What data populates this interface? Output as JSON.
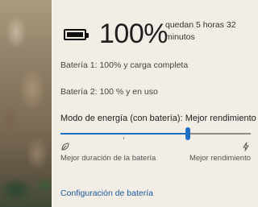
{
  "battery": {
    "percent": "100%",
    "remaining": "quedan 5 horas 32 minutos",
    "battery1_status": "Batería 1: 100% y carga completa",
    "battery2_status": "Batería 2: 100 % y en uso",
    "level_fraction": 1.0
  },
  "power_mode": {
    "label": "Modo de energía (con batería): Mejor rendimiento",
    "slider_value": 0.67,
    "tick_marks": [
      0.33,
      0.67
    ],
    "min_label": "Mejor duración de la batería",
    "max_label": "Mejor rendimiento",
    "min_icon": "leaf-icon",
    "max_icon": "bolt-icon"
  },
  "settings_link": "Configuración de batería",
  "colors": {
    "accent": "#1f6fc4",
    "flyout_background": "#f2ede5",
    "link": "#1a5aa0"
  }
}
